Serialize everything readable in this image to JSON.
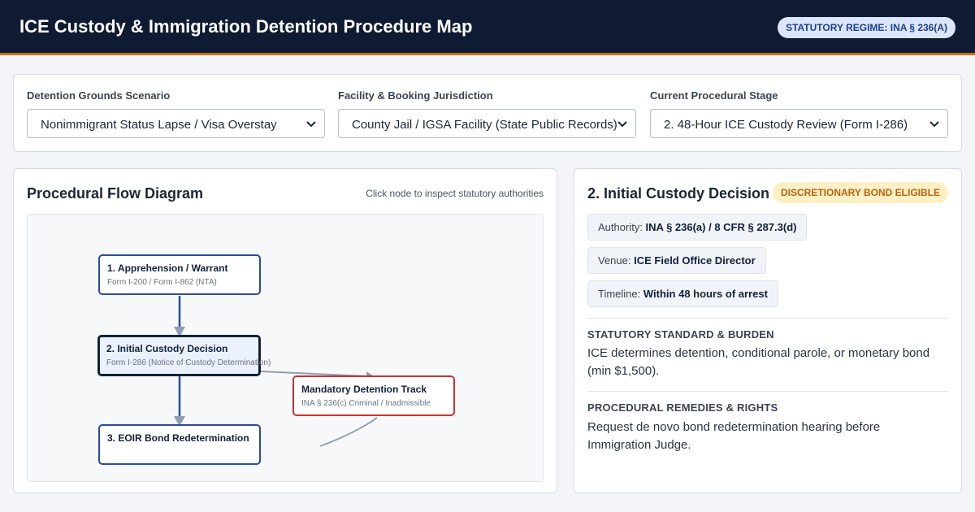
{
  "header": {
    "title": "ICE Custody & Immigration Detention Procedure Map",
    "regime_badge": "STATUTORY REGIME: INA § 236(A)"
  },
  "filters": {
    "scenario": {
      "label": "Detention Grounds Scenario",
      "value": "Nonimmigrant Status Lapse / Visa Overstay"
    },
    "facility": {
      "label": "Facility & Booking Jurisdiction",
      "value": "County Jail / IGSA Facility (State Public Records)"
    },
    "stage": {
      "label": "Current Procedural Stage",
      "value": "2. 48-Hour ICE Custody Review (Form I-286)"
    }
  },
  "flow": {
    "title": "Procedural Flow Diagram",
    "hint": "Click node to inspect statutory authorities",
    "nodes": [
      {
        "title": "1. Apprehension / Warrant",
        "sub": "Form I-200 / Form I-862 (NTA)"
      },
      {
        "title": "2. Initial Custody Decision",
        "sub": "Form I-286 (Notice of Custody Determination)"
      },
      {
        "title": "Mandatory Detention Track",
        "sub": "INA § 236(c) Criminal / Inadmissible"
      },
      {
        "title": "3. EOIR Bond Redetermination",
        "sub": ""
      }
    ]
  },
  "detail": {
    "title": "2. Initial Custody Decision",
    "badge": "DISCRETIONARY BOND ELIGIBLE",
    "authority_label": "Authority:",
    "authority_value": "INA § 236(a) / 8 CFR § 287.3(d)",
    "venue_label": "Venue:",
    "venue_value": "ICE Field Office Director",
    "timeline_label": "Timeline:",
    "timeline_value": "Within 48 hours of arrest",
    "standard_heading": "STATUTORY STANDARD & BURDEN",
    "standard_text": "ICE determines detention, conditional parole, or monetary bond (min $1,500).",
    "remedies_heading": "PROCEDURAL REMEDIES & RIGHTS",
    "remedies_text": "Request de novo bond redetermination hearing before Immigration Judge."
  },
  "colors": {
    "header_bg": "#0f1b33",
    "accent_orange": "#d06a12",
    "node_border": "#2b4a9e",
    "mandatory_red": "#c83333",
    "badge_blue": "#dbe6fb",
    "badge_amber": "#fdf0c4"
  }
}
